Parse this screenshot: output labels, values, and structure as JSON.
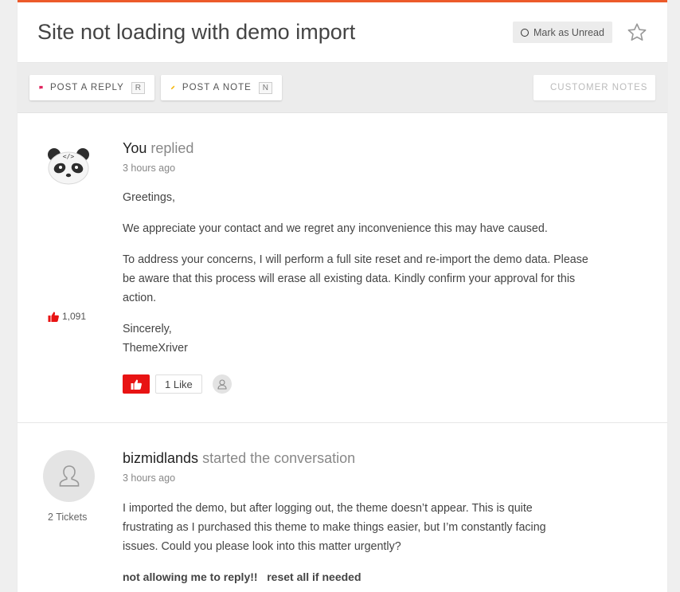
{
  "conversation": {
    "title": "Site not loading with demo import",
    "mark_unread_label": "Mark as Unread",
    "star_icon": "star-outline-icon"
  },
  "toolbar": {
    "reply_label": "POST A REPLY",
    "reply_key": "R",
    "note_label": "POST A NOTE",
    "note_key": "N",
    "customer_notes_label": "CUSTOMER NOTES"
  },
  "messages": [
    {
      "author": "You",
      "action": "replied",
      "time": "3 hours ago",
      "votes": "1,091",
      "paragraphs": [
        "Greetings,",
        "We appreciate your contact and we regret any inconvenience this may have caused.",
        "To address your concerns, I will perform a full site reset and re-import the demo data. Please be aware that this process will erase all existing data. Kindly confirm your approval for this action.",
        "Sincerely,\nThemeXriver"
      ],
      "likes_label": "1 Like"
    },
    {
      "author": "bizmidlands",
      "action": "started the conversation",
      "time": "3 hours ago",
      "tickets": "2 Tickets",
      "paragraphs": [
        "I imported the demo, but after logging out, the theme doesn’t appear. This is quite frustrating as I purchased this theme to make things easier, but I’m constantly facing issues. Could you please look into this matter urgently?"
      ],
      "bold_text": "not allowing me to reply!!   reset all if needed"
    }
  ],
  "colors": {
    "accent_top": "#ec5a2a",
    "like_red": "#e81313",
    "reply_icon": "#e0245e",
    "note_icon": "#f5b400"
  }
}
